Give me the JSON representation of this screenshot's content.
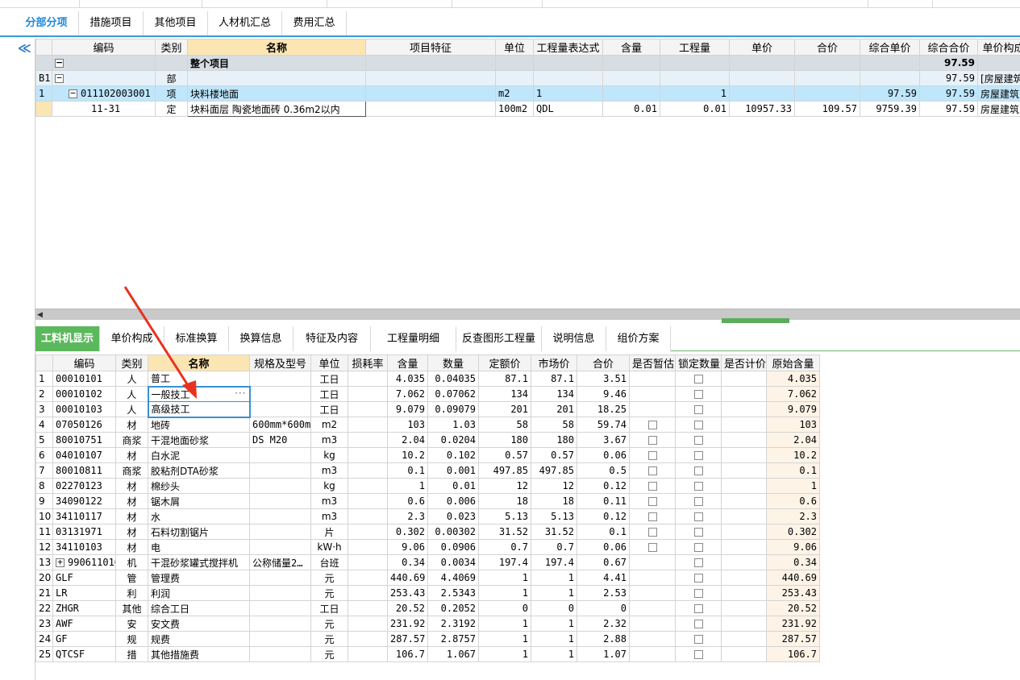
{
  "tabs": [
    "分部分项",
    "措施项目",
    "其他项目",
    "人材机汇总",
    "费用汇总"
  ],
  "top_grid": {
    "headers": [
      "编码",
      "类别",
      "名称",
      "项目特征",
      "单位",
      "工程量表达式",
      "含量",
      "工程量",
      "单价",
      "合价",
      "综合单价",
      "综合合价",
      "单价构成"
    ],
    "summary": {
      "name": "整个项目",
      "total": "97.59"
    },
    "rows": [
      {
        "rn": "B1",
        "code": "",
        "type": "部",
        "name": "",
        "feature": "",
        "unit": "",
        "expr": "",
        "content": "",
        "qty": "",
        "price": "",
        "total": "",
        "uprice": "",
        "utotal": "97.59",
        "comp": "[房屋建筑"
      },
      {
        "rn": "1",
        "code": "011102003001",
        "type": "项",
        "name": "块料楼地面",
        "feature": "",
        "unit": "m2",
        "expr": "1",
        "content": "",
        "qty": "1",
        "price": "",
        "total": "",
        "uprice": "97.59",
        "utotal": "97.59",
        "comp": "房屋建筑"
      },
      {
        "rn": "",
        "code": "11-31",
        "type": "定",
        "name": "块料面层 陶瓷地面砖 0.36m2以内",
        "feature": "",
        "unit": "100m2",
        "expr": "QDL",
        "content": "0.01",
        "qty": "0.01",
        "price": "10957.33",
        "total": "109.57",
        "uprice": "9759.39",
        "utotal": "97.59",
        "comp": "房屋建筑"
      }
    ]
  },
  "bottom_tabs": [
    "工料机显示",
    "单价构成",
    "标准换算",
    "换算信息",
    "特征及内容",
    "工程量明细",
    "反查图形工程量",
    "说明信息",
    "组价方案"
  ],
  "bottom_grid": {
    "headers": [
      "编码",
      "类别",
      "名称",
      "规格及型号",
      "单位",
      "损耗率",
      "含量",
      "数量",
      "定额价",
      "市场价",
      "合价",
      "是否暂估",
      "锁定数量",
      "是否计价",
      "原始含量"
    ],
    "rows": [
      {
        "rn": "1",
        "code": "00010101",
        "type": "人",
        "name": "普工",
        "spec": "",
        "unit": "工日",
        "loss": "",
        "content": "4.035",
        "qty": "0.04035",
        "dprice": "87.1",
        "mprice": "87.1",
        "total": "3.51",
        "est": false,
        "orig": "4.035"
      },
      {
        "rn": "2",
        "code": "00010102",
        "type": "人",
        "name": "一般技工",
        "spec": "",
        "unit": "工日",
        "loss": "",
        "content": "7.062",
        "qty": "0.07062",
        "dprice": "134",
        "mprice": "134",
        "total": "9.46",
        "est": false,
        "orig": "7.062"
      },
      {
        "rn": "3",
        "code": "00010103",
        "type": "人",
        "name": "高级技工",
        "spec": "",
        "unit": "工日",
        "loss": "",
        "content": "9.079",
        "qty": "0.09079",
        "dprice": "201",
        "mprice": "201",
        "total": "18.25",
        "est": false,
        "orig": "9.079"
      },
      {
        "rn": "4",
        "code": "07050126",
        "type": "材",
        "name": "地砖",
        "spec": "600mm*600mm",
        "unit": "m2",
        "loss": "",
        "content": "103",
        "qty": "1.03",
        "dprice": "58",
        "mprice": "58",
        "total": "59.74",
        "est": true,
        "orig": "103"
      },
      {
        "rn": "5",
        "code": "80010751",
        "type": "商浆",
        "name": "干混地面砂浆",
        "spec": "DS M20",
        "unit": "m3",
        "loss": "",
        "content": "2.04",
        "qty": "0.0204",
        "dprice": "180",
        "mprice": "180",
        "total": "3.67",
        "est": true,
        "orig": "2.04"
      },
      {
        "rn": "6",
        "code": "04010107",
        "type": "材",
        "name": "白水泥",
        "spec": "",
        "unit": "kg",
        "loss": "",
        "content": "10.2",
        "qty": "0.102",
        "dprice": "0.57",
        "mprice": "0.57",
        "total": "0.06",
        "est": true,
        "orig": "10.2"
      },
      {
        "rn": "7",
        "code": "80010811",
        "type": "商浆",
        "name": "胶粘剂DTA砂浆",
        "spec": "",
        "unit": "m3",
        "loss": "",
        "content": "0.1",
        "qty": "0.001",
        "dprice": "497.85",
        "mprice": "497.85",
        "total": "0.5",
        "est": true,
        "orig": "0.1"
      },
      {
        "rn": "8",
        "code": "02270123",
        "type": "材",
        "name": "棉纱头",
        "spec": "",
        "unit": "kg",
        "loss": "",
        "content": "1",
        "qty": "0.01",
        "dprice": "12",
        "mprice": "12",
        "total": "0.12",
        "est": true,
        "orig": "1"
      },
      {
        "rn": "9",
        "code": "34090122",
        "type": "材",
        "name": "锯木屑",
        "spec": "",
        "unit": "m3",
        "loss": "",
        "content": "0.6",
        "qty": "0.006",
        "dprice": "18",
        "mprice": "18",
        "total": "0.11",
        "est": true,
        "orig": "0.6"
      },
      {
        "rn": "10",
        "code": "34110117",
        "type": "材",
        "name": "水",
        "spec": "",
        "unit": "m3",
        "loss": "",
        "content": "2.3",
        "qty": "0.023",
        "dprice": "5.13",
        "mprice": "5.13",
        "total": "0.12",
        "est": true,
        "orig": "2.3"
      },
      {
        "rn": "11",
        "code": "03131971",
        "type": "材",
        "name": "石料切割锯片",
        "spec": "",
        "unit": "片",
        "loss": "",
        "content": "0.302",
        "qty": "0.00302",
        "dprice": "31.52",
        "mprice": "31.52",
        "total": "0.1",
        "est": true,
        "orig": "0.302"
      },
      {
        "rn": "12",
        "code": "34110103",
        "type": "材",
        "name": "电",
        "spec": "",
        "unit": "kW·h",
        "loss": "",
        "content": "9.06",
        "qty": "0.0906",
        "dprice": "0.7",
        "mprice": "0.7",
        "total": "0.06",
        "est": true,
        "orig": "9.06"
      },
      {
        "rn": "13",
        "code": "990611010",
        "type": "机",
        "name": "干混砂浆罐式搅拌机",
        "spec": "公称储量2…",
        "unit": "台班",
        "loss": "",
        "content": "0.34",
        "qty": "0.0034",
        "dprice": "197.4",
        "mprice": "197.4",
        "total": "0.67",
        "est": false,
        "orig": "0.34"
      },
      {
        "rn": "20",
        "code": "GLF",
        "type": "管",
        "name": "管理费",
        "spec": "",
        "unit": "元",
        "loss": "",
        "content": "440.69",
        "qty": "4.4069",
        "dprice": "1",
        "mprice": "1",
        "total": "4.41",
        "est": false,
        "orig": "440.69"
      },
      {
        "rn": "21",
        "code": "LR",
        "type": "利",
        "name": "利润",
        "spec": "",
        "unit": "元",
        "loss": "",
        "content": "253.43",
        "qty": "2.5343",
        "dprice": "1",
        "mprice": "1",
        "total": "2.53",
        "est": false,
        "orig": "253.43"
      },
      {
        "rn": "22",
        "code": "ZHGR",
        "type": "其他",
        "name": "综合工日",
        "spec": "",
        "unit": "工日",
        "loss": "",
        "content": "20.52",
        "qty": "0.2052",
        "dprice": "0",
        "mprice": "0",
        "total": "0",
        "est": false,
        "orig": "20.52"
      },
      {
        "rn": "23",
        "code": "AWF",
        "type": "安",
        "name": "安文费",
        "spec": "",
        "unit": "元",
        "loss": "",
        "content": "231.92",
        "qty": "2.3192",
        "dprice": "1",
        "mprice": "1",
        "total": "2.32",
        "est": false,
        "orig": "231.92"
      },
      {
        "rn": "24",
        "code": "GF",
        "type": "规",
        "name": "规费",
        "spec": "",
        "unit": "元",
        "loss": "",
        "content": "287.57",
        "qty": "2.8757",
        "dprice": "1",
        "mprice": "1",
        "total": "2.88",
        "est": false,
        "orig": "287.57"
      },
      {
        "rn": "25",
        "code": "QTCSF",
        "type": "措",
        "name": "其他措施费",
        "spec": "",
        "unit": "元",
        "loss": "",
        "content": "106.7",
        "qty": "1.067",
        "dprice": "1",
        "mprice": "1",
        "total": "1.07",
        "est": false,
        "orig": "106.7"
      }
    ]
  },
  "ellipsis": "···",
  "colors": {
    "accent": "#1e88d8",
    "bottom_tab_active": "#5cb85c",
    "header_highlight": "#fbe5b2",
    "selected_row": "#bfe6fb",
    "annotation_arrow": "#e8321e"
  }
}
